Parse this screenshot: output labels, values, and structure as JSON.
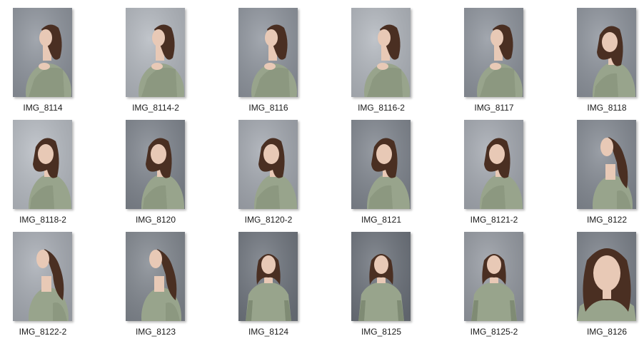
{
  "files": [
    {
      "name": "IMG_8114",
      "pose": "profile-left",
      "bg": "#8e949d"
    },
    {
      "name": "IMG_8114-2",
      "pose": "profile-left",
      "bg": "#b3b8bf"
    },
    {
      "name": "IMG_8116",
      "pose": "profile-left",
      "bg": "#8f959e"
    },
    {
      "name": "IMG_8116-2",
      "pose": "profile-left",
      "bg": "#b2b7be"
    },
    {
      "name": "IMG_8117",
      "pose": "profile-left",
      "bg": "#8e949d"
    },
    {
      "name": "IMG_8118",
      "pose": "three-quarter",
      "bg": "#8d939c"
    },
    {
      "name": "IMG_8118-2",
      "pose": "three-quarter",
      "bg": "#b7bcc3"
    },
    {
      "name": "IMG_8120",
      "pose": "three-quarter",
      "bg": "#7f858e"
    },
    {
      "name": "IMG_8120-2",
      "pose": "three-quarter",
      "bg": "#a3a8b0"
    },
    {
      "name": "IMG_8121",
      "pose": "three-quarter",
      "bg": "#80868f"
    },
    {
      "name": "IMG_8121-2",
      "pose": "three-quarter",
      "bg": "#a4a9b1"
    },
    {
      "name": "IMG_8122",
      "pose": "head-back-right",
      "bg": "#848a93"
    },
    {
      "name": "IMG_8122-2",
      "pose": "head-back-right",
      "bg": "#a7acb4"
    },
    {
      "name": "IMG_8123",
      "pose": "head-back-right",
      "bg": "#81878f"
    },
    {
      "name": "IMG_8124",
      "pose": "frontal",
      "bg": "#6f757e"
    },
    {
      "name": "IMG_8125",
      "pose": "frontal",
      "bg": "#6c727b"
    },
    {
      "name": "IMG_8125-2",
      "pose": "frontal",
      "bg": "#959aa2"
    },
    {
      "name": "IMG_8126",
      "pose": "closeup",
      "bg": "#7a8089"
    }
  ],
  "colors": {
    "hair": "#4a2f22",
    "skin": "#e8c9b6",
    "sweater": "#98a48c",
    "sweaterShade": "#7f8b74"
  }
}
